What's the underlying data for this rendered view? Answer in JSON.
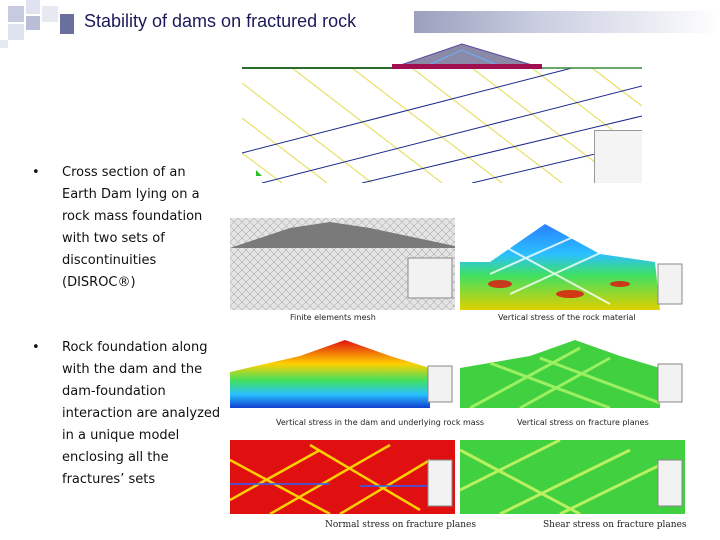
{
  "slide": {
    "title": "Stability of dams on fractured rock",
    "bullets": [
      {
        "text": "Cross section of an Earth Dam lying on a rock mass foundation with two sets of discontinuities (DISROC®)"
      },
      {
        "text": "Rock foundation along with the dam and the dam-foundation interaction are analyzed in a unique model enclosing all the fractures’ sets"
      }
    ]
  },
  "figures": {
    "fig_mesh_caption": "Finite elements mesh",
    "fig_vertical_rock_caption": "Vertical stress of the rock material",
    "fig_vertical_dam_caption": "Vertical stress in the dam and underlying rock mass",
    "fig_vertical_fracture_caption": "Vertical stress on fracture planes",
    "fig_normal_caption": "Normal stress on fracture planes",
    "fig_shear_caption": "Shear stress on fracture planes"
  },
  "colors": {
    "title_text": "#1a1a5a",
    "fracture_lines": "#e8e06a",
    "fracture_set_2": "#1a2a8a",
    "hot": "#e01010",
    "warm": "#ffd000",
    "cool": "#2ac02a",
    "cold": "#1040d0"
  }
}
